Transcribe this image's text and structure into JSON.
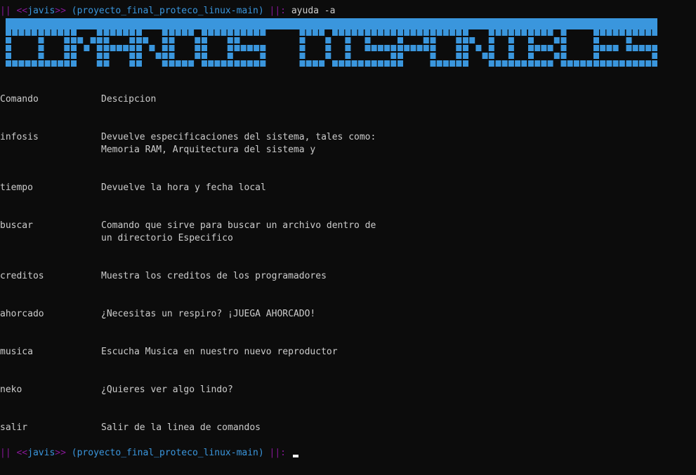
{
  "prompt": {
    "pipes_left": "||",
    "lt": "<<",
    "user": "javis",
    "gt": ">>",
    "cwd": "(proyecto_final_proteco_linux-main)",
    "pipes_right": "||:",
    "command": "ayuda -a"
  },
  "banner": {
    "text": "COMANDOS DISPONIBLES",
    "color": "#3a96dd"
  },
  "table": {
    "header_command": "Comando",
    "header_description": "Descipcion",
    "rows": [
      {
        "name": "infosis",
        "desc1": "Devuelve especificaciones del sistema, tales como:",
        "desc2": "Memoria RAM, Arquitectura del sistema y"
      },
      {
        "name": "tiempo",
        "desc1": "Devuelve la hora y fecha local",
        "desc2": ""
      },
      {
        "name": "buscar",
        "desc1": "Comando que sirve para buscar un archivo dentro de",
        "desc2": "un directorio Especifico"
      },
      {
        "name": "creditos",
        "desc1": "Muestra los creditos de los programadores",
        "desc2": ""
      },
      {
        "name": "ahorcado",
        "desc1": "¿Necesitas un respiro? ¡JUEGA AHORCADO!",
        "desc2": ""
      },
      {
        "name": "musica",
        "desc1": "Escucha Musica en nuestro nuevo reproductor",
        "desc2": ""
      },
      {
        "name": "neko",
        "desc1": "¿Quieres ver algo lindo?",
        "desc2": ""
      },
      {
        "name": "salir",
        "desc1": "Salir de la linea de comandos",
        "desc2": ""
      }
    ]
  },
  "prompt2": {
    "pipes_left": "||",
    "lt": "<<",
    "user": "javis",
    "gt": ">>",
    "cwd": "(proyecto_final_proteco_linux-main)",
    "pipes_right": "||:"
  }
}
